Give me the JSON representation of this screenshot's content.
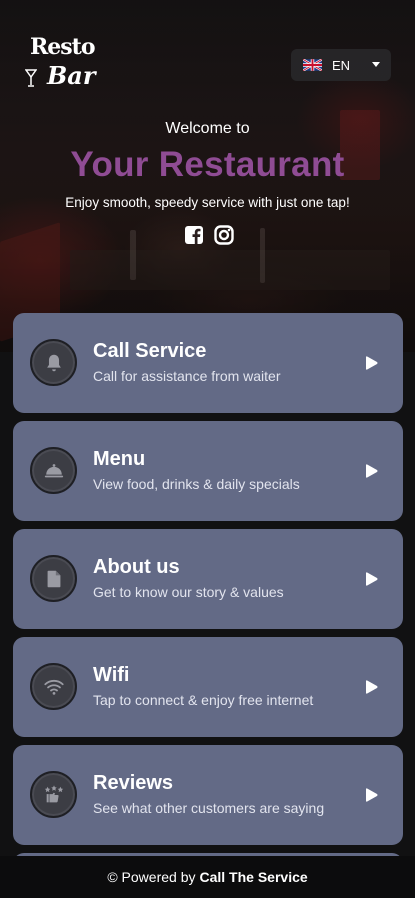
{
  "logo": {
    "line1": "Resto",
    "line2": "Bar"
  },
  "language": {
    "code": "EN",
    "flag": "uk-flag-icon"
  },
  "header": {
    "welcome": "Welcome to",
    "title": "Your Restaurant",
    "tagline": "Enjoy smooth, speedy service with just one tap!",
    "title_color": "#8f4c94"
  },
  "socials": [
    "facebook-icon",
    "instagram-icon"
  ],
  "cards": [
    {
      "title": "Call Service",
      "subtitle": "Call for assistance from waiter",
      "icon": "bell-icon"
    },
    {
      "title": "Menu",
      "subtitle": "View food, drinks & daily specials",
      "icon": "cloche-icon"
    },
    {
      "title": "About us",
      "subtitle": "Get to know our story & values",
      "icon": "document-icon"
    },
    {
      "title": "Wifi",
      "subtitle": "Tap to connect & enjoy free internet",
      "icon": "wifi-icon"
    },
    {
      "title": "Reviews",
      "subtitle": "See what other customers are saying",
      "icon": "review-stars-icon"
    }
  ],
  "footer": {
    "prefix": "© Powered by",
    "brand": "Call The Service"
  },
  "colors": {
    "card": "#636a86",
    "icon_circle": "#3c3d44",
    "background": "#111112"
  }
}
